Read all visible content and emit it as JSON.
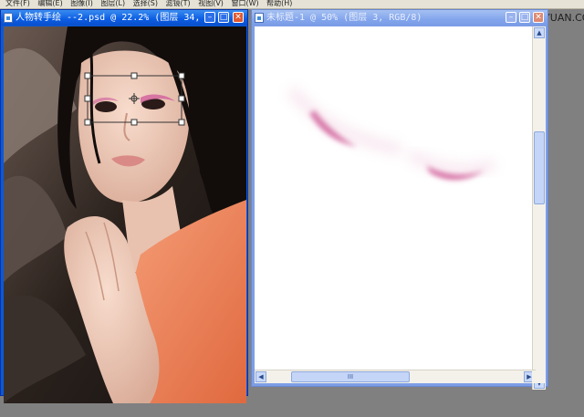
{
  "menubar": {
    "items": [
      "文件(F)",
      "编辑(E)",
      "图像(I)",
      "图层(L)",
      "选择(S)",
      "滤镜(T)",
      "视图(V)",
      "窗口(W)",
      "帮助(H)"
    ]
  },
  "watermark": {
    "text": "思缘设计论坛 WWW.MISSYUAN.COM"
  },
  "windows": {
    "left": {
      "title": "人物转手绘 --2.psd @ 22.2% (图层 34, ...",
      "buttons": {
        "minimize": "–",
        "maximize": "□",
        "close": "✕"
      },
      "state": "active"
    },
    "right": {
      "title": "未标题-1 @ 50% (图层 3, RGB/8)",
      "buttons": {
        "minimize": "–",
        "maximize": "□",
        "close": "✕"
      },
      "state": "inactive",
      "scroll_grip": "III"
    }
  },
  "colors": {
    "desktop": "#808080",
    "title_active": "#0b5ce3",
    "title_inactive": "#83a5ec",
    "eyeshadow": "#d46aa0",
    "skin": "#f2cfbe",
    "shirt": "#f0875a"
  },
  "icons": [
    "document-icon",
    "minimize-icon",
    "maximize-icon",
    "close-icon",
    "scroll-up-icon",
    "scroll-down-icon",
    "scroll-left-icon",
    "scroll-right-icon",
    "crosshair-icon"
  ]
}
